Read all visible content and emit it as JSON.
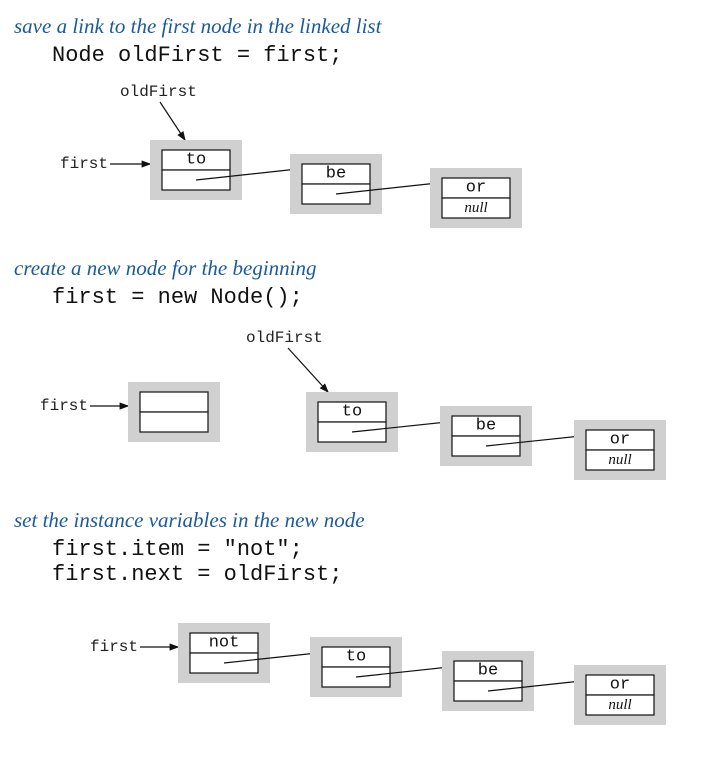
{
  "step1": {
    "caption": "save a link to the first node in the linked list",
    "code": "Node oldFirst = first;",
    "ptr_first": "first",
    "ptr_oldFirst": "oldFirst",
    "nodes": [
      {
        "item": "to",
        "next": "link"
      },
      {
        "item": "be",
        "next": "link"
      },
      {
        "item": "or",
        "next": "null"
      }
    ]
  },
  "step2": {
    "caption": "create a new node for the beginning",
    "code": "first = new Node();",
    "ptr_first": "first",
    "ptr_oldFirst": "oldFirst",
    "nodes": [
      {
        "item": "",
        "next": ""
      },
      {
        "item": "to",
        "next": "link"
      },
      {
        "item": "be",
        "next": "link"
      },
      {
        "item": "or",
        "next": "null"
      }
    ]
  },
  "step3": {
    "caption": "set the instance variables in the new node",
    "code": "first.item = \"not\";\nfirst.next = oldFirst;",
    "ptr_first": "first",
    "nodes": [
      {
        "item": "not",
        "next": "link"
      },
      {
        "item": "to",
        "next": "link"
      },
      {
        "item": "be",
        "next": "link"
      },
      {
        "item": "or",
        "next": "null"
      }
    ]
  }
}
